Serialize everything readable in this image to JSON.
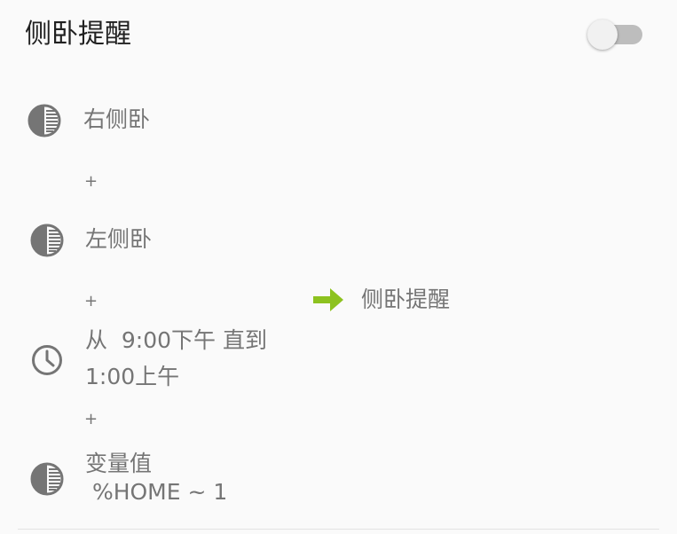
{
  "profile": {
    "title": "侧卧提醒",
    "enabled": false
  },
  "conditions": [
    {
      "icon": "half-circle-state-icon",
      "label": "右侧卧"
    },
    {
      "icon": "half-circle-state-icon",
      "label": "左侧卧"
    },
    {
      "icon": "clock-icon",
      "line1": "从  9:00下午 直到",
      "line2": "1:00上午"
    },
    {
      "icon": "half-circle-state-icon",
      "line1": "变量值",
      "line2": " %HOME ~ 1"
    }
  ],
  "joiner": "+",
  "task": {
    "icon": "green-arrow-right-icon",
    "label": "侧卧提醒"
  },
  "colors": {
    "arrow": "#8dc21f",
    "icon": "#757575",
    "text": "#757575",
    "title": "#212121"
  }
}
